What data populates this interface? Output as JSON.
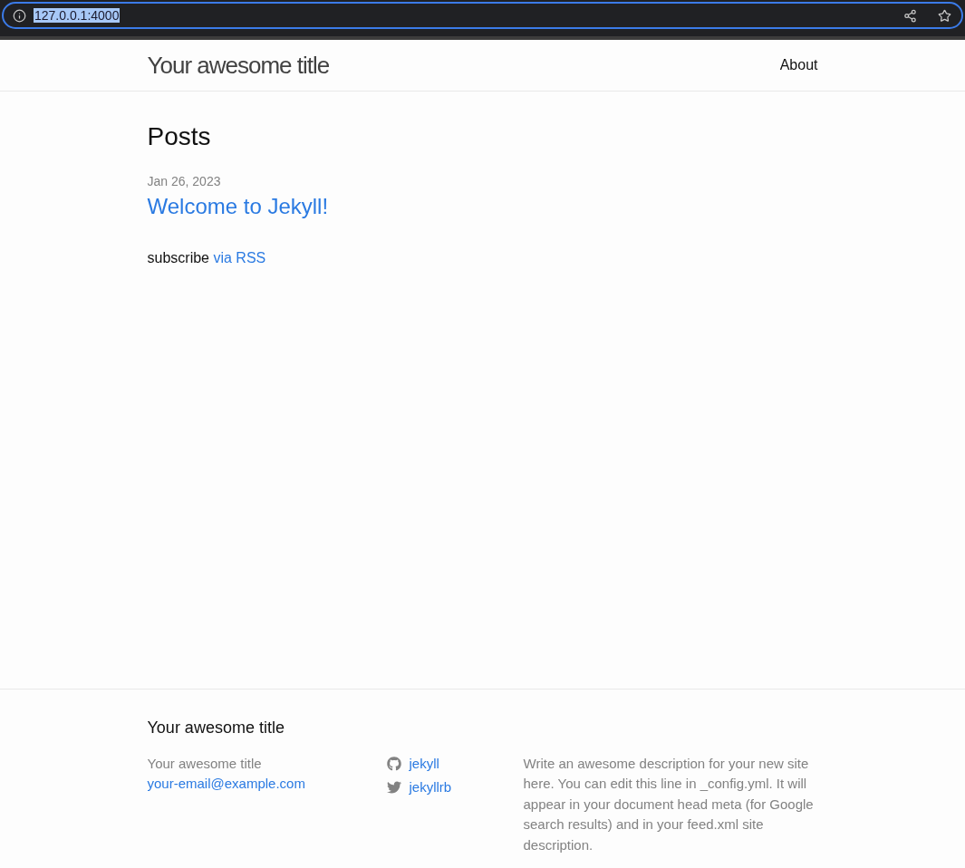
{
  "browser": {
    "url": "127.0.0.1:4000"
  },
  "header": {
    "site_title": "Your awesome title",
    "nav": [
      {
        "label": "About"
      }
    ]
  },
  "main": {
    "heading": "Posts",
    "posts": [
      {
        "date": "Jan 26, 2023",
        "title": "Welcome to Jekyll!"
      }
    ],
    "subscribe": {
      "text": "subscribe",
      "link": "via RSS"
    }
  },
  "footer": {
    "heading": "Your awesome title",
    "name": "Your awesome title",
    "email": "your-email@example.com",
    "social": [
      {
        "kind": "github",
        "label": "jekyll"
      },
      {
        "kind": "twitter",
        "label": "jekyllrb"
      }
    ],
    "description": "Write an awesome description for your new site here. You can edit this line in _config.yml. It will appear in your document head meta (for Google search results) and in your feed.xml site description."
  }
}
